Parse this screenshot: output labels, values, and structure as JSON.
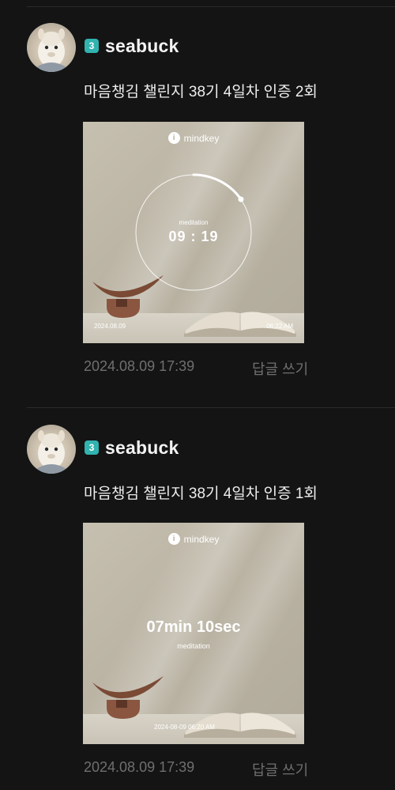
{
  "posts": [
    {
      "badge": "3",
      "username": "seabuck",
      "text": "마음챙김 챌린지 38기 4일차 인증 2회",
      "photo": {
        "brand": "mindkey",
        "label": "meditation",
        "timer": "09 : 19",
        "date": "2024.08.09",
        "time": "06:22 AM"
      },
      "timestamp": "2024.08.09 17:39",
      "reply_label": "답글 쓰기"
    },
    {
      "badge": "3",
      "username": "seabuck",
      "text": "마음챙김 챌린지 38기 4일차 인증 1회",
      "photo": {
        "brand": "mindkey",
        "duration": "07min 10sec",
        "label": "meditation",
        "datetime": "2024-08-09 06:20 AM"
      },
      "timestamp": "2024.08.09 17:39",
      "reply_label": "답글 쓰기"
    }
  ],
  "colors": {
    "background": "#141414",
    "badge": "#31b3b0",
    "meta_text": "#6f6f6f"
  }
}
